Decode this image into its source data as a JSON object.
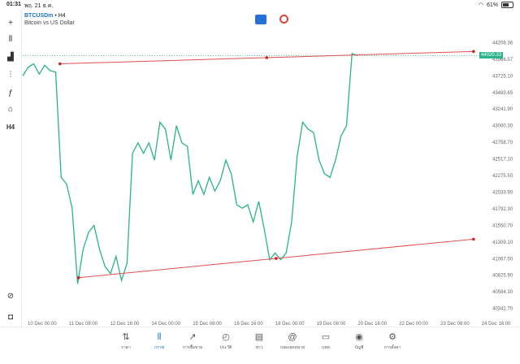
{
  "status_bar": {
    "time": "01:31",
    "date": "พฤ. 21 ธ.ค.",
    "battery": "61%"
  },
  "symbol": {
    "ticker": "BTCUSDm",
    "timeframe": "H4",
    "description": "Bitcoin vs US Dollar"
  },
  "left_tools": [
    {
      "name": "crosshair-icon",
      "glyph": "+"
    },
    {
      "name": "candles-icon",
      "glyph": "⫴"
    },
    {
      "name": "indicators-icon",
      "glyph": "▟"
    },
    {
      "name": "objects-icon",
      "glyph": "⫶"
    },
    {
      "name": "function-icon",
      "glyph": "ƒ"
    },
    {
      "name": "shapes-icon",
      "glyph": "⌂"
    },
    {
      "name": "timeframe-label",
      "glyph": "H4"
    }
  ],
  "price_axis": {
    "labels": [
      "44208.36",
      "43966.57",
      "43725.10",
      "43483.65",
      "43241.90",
      "43000.30",
      "42758.70",
      "42517.10",
      "42275.50",
      "42033.90",
      "41792.30",
      "41550.70",
      "41309.10",
      "41067.50",
      "40825.90",
      "40584.30",
      "40342.70"
    ],
    "current_price": "44020.33",
    "current_color": "#2bb389"
  },
  "time_axis": {
    "labels": [
      "10 Dec 00:00",
      "11 Dec 08:00",
      "12 Dec 16:00",
      "14 Dec 00:00",
      "15 Dec 08:00",
      "16 Dec 16:00",
      "18 Dec 00:00",
      "19 Dec 08:00",
      "20 Dec 16:00",
      "22 Dec 00:00",
      "23 Dec 08:00",
      "24 Dec 16:00"
    ]
  },
  "chart_data": {
    "type": "line",
    "series": [
      {
        "name": "BTCUSDm",
        "color": "#2bb389",
        "values": [
          43725,
          43850,
          43900,
          43750,
          43880,
          43800,
          43780,
          42250,
          42150,
          41800,
          40700,
          41200,
          41450,
          41550,
          41200,
          40950,
          40850,
          41100,
          40750,
          41000,
          42600,
          42750,
          42600,
          42750,
          42500,
          43050,
          42950,
          42500,
          43000,
          42750,
          42700,
          42000,
          42200,
          42000,
          42250,
          42050,
          42200,
          42500,
          42300,
          41850,
          41800,
          41850,
          41600,
          41900,
          41500,
          41050,
          41150,
          41050,
          41150,
          41600,
          42550,
          43050,
          42950,
          42900,
          42500,
          42300,
          42250,
          42500,
          42850,
          43000,
          44050,
          44020
        ]
      }
    ],
    "trendlines": [
      {
        "color": "#e05050",
        "points": [
          [
            0.08,
            43900
          ],
          [
            0.97,
            44080
          ]
        ]
      },
      {
        "color": "#e05050",
        "points": [
          [
            0.12,
            40790
          ],
          [
            0.97,
            41350
          ]
        ]
      }
    ],
    "ylim": [
      40220,
      44450
    ]
  },
  "tabs": [
    {
      "label": "ราคา",
      "glyph": "⇅",
      "active": false
    },
    {
      "label": "กราฟ",
      "glyph": "⫴",
      "active": true
    },
    {
      "label": "การซื้อขาย",
      "glyph": "↗",
      "active": false
    },
    {
      "label": "ประวัติ",
      "glyph": "◴",
      "active": false
    },
    {
      "label": "ข่าว",
      "glyph": "▤",
      "active": false
    },
    {
      "label": "กล่องจดหมาย",
      "glyph": "@",
      "active": false
    },
    {
      "label": "แชท",
      "glyph": "▭",
      "active": false
    },
    {
      "label": "บัญชี",
      "glyph": "◉",
      "active": false
    },
    {
      "label": "การตั้งค่า",
      "glyph": "⚙",
      "active": false
    }
  ]
}
